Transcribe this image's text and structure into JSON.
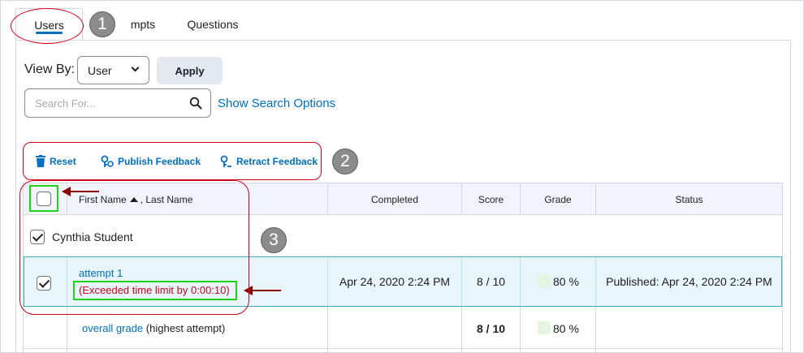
{
  "tabs": [
    {
      "label": "Users"
    },
    {
      "label": "Attempts"
    },
    {
      "label": "Questions"
    }
  ],
  "tab_attempts_visible": "mpts",
  "view_by": {
    "label": "View By:",
    "selected": "User",
    "apply_label": "Apply"
  },
  "search": {
    "placeholder": "Search For...",
    "options_link": "Show Search Options"
  },
  "toolbar": {
    "reset": "Reset",
    "publish": "Publish Feedback",
    "retract": "Retract Feedback"
  },
  "annotations": {
    "badge1": "1",
    "badge2": "2",
    "badge3": "3"
  },
  "table": {
    "headers": {
      "name": "First Name",
      "name_sort_icon": "sort-up-icon",
      "name_rest": ", Last Name",
      "completed": "Completed",
      "score": "Score",
      "grade": "Grade",
      "status": "Status"
    },
    "user_row": {
      "name": "Cynthia Student",
      "checked": true
    },
    "attempt_row": {
      "attempt": "attempt 1",
      "warning": "(Exceeded time limit by 0:00:10)",
      "completed": "Apr 24, 2020 2:24 PM",
      "score": "8 / 10",
      "grade": "80 %",
      "status": "Published: Apr 24, 2020 2:24 PM",
      "checked": true
    },
    "overall_row": {
      "link": "overall grade",
      "note": "(highest attempt)",
      "score": "8 / 10",
      "grade": "80 %"
    }
  },
  "colors": {
    "link": "#006fbf",
    "annotation_red": "#d0021b",
    "highlight_green": "#20d21a",
    "selected_row": "#e8f6fb"
  }
}
